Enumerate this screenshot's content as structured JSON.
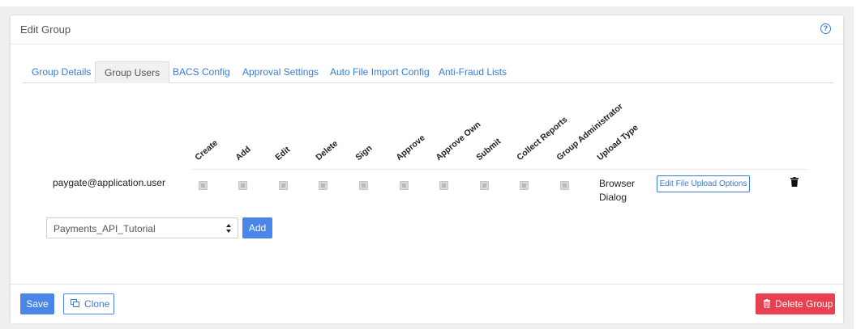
{
  "card": {
    "title": "Edit Group"
  },
  "tabs": [
    {
      "label": "Group Details"
    },
    {
      "label": "Group Users"
    },
    {
      "label": "BACS Config"
    },
    {
      "label": "Approval Settings"
    },
    {
      "label": "Auto File Import Config"
    },
    {
      "label": "Anti-Fraud Lists"
    }
  ],
  "active_tab": "Group Users",
  "permission_columns": [
    "Create",
    "Add",
    "Edit",
    "Delete",
    "Sign",
    "Approve",
    "Approve Own",
    "Submit",
    "Collect Reports",
    "Group Administrator",
    "Upload Type"
  ],
  "users": [
    {
      "email": "paygate@application.user",
      "permissions": [
        false,
        false,
        false,
        false,
        false,
        false,
        false,
        false,
        false,
        false
      ],
      "upload_type": "Browser Dialog",
      "edit_upload_label": "Edit File Upload Options"
    }
  ],
  "add_user": {
    "selected": "Payments_API_Tutorial",
    "button_label": "Add"
  },
  "footer": {
    "save_label": "Save",
    "clone_label": "Clone",
    "delete_label": "Delete Group"
  },
  "colors": {
    "primary": "#4a86e8",
    "link": "#3a7bd5",
    "danger": "#e8404f"
  }
}
